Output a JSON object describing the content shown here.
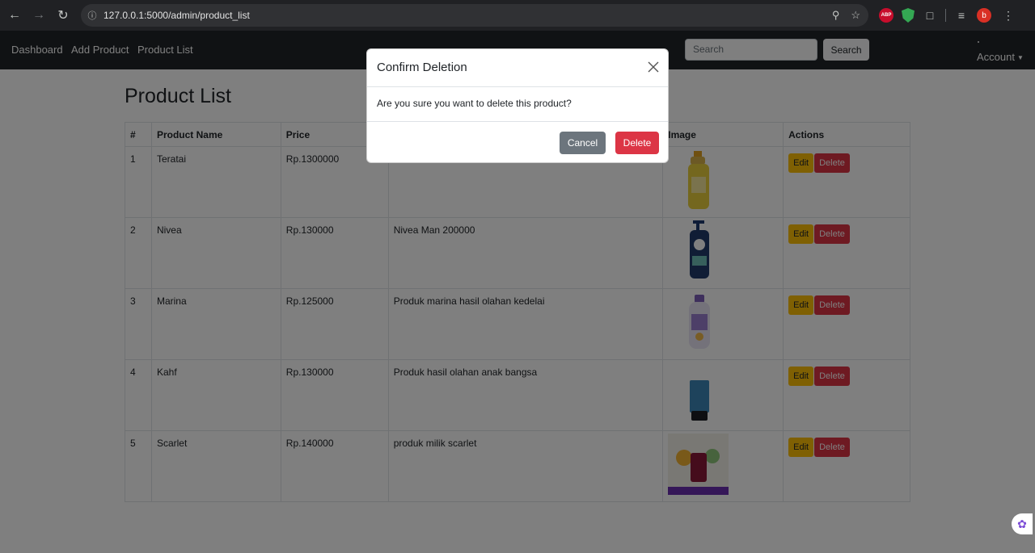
{
  "browser": {
    "url": "127.0.0.1:5000/admin/product_list",
    "extensions": {
      "abp_label": "ABP",
      "profile_initial": "b"
    }
  },
  "navbar": {
    "links": [
      "Dashboard",
      "Add Product",
      "Product List"
    ],
    "search_placeholder": "Search",
    "search_button": "Search",
    "account_label": "Account"
  },
  "page": {
    "title": "Product List",
    "columns": [
      "#",
      "Product Name",
      "Price",
      "",
      "Image",
      "Actions"
    ],
    "rows": [
      {
        "num": "1",
        "name": "Teratai",
        "price": "Rp.1300000",
        "description": "",
        "image": "yellow-bottle"
      },
      {
        "num": "2",
        "name": "Nivea",
        "price": "Rp.130000",
        "description": "Nivea Man 200000",
        "image": "blue-pump-bottle"
      },
      {
        "num": "3",
        "name": "Marina",
        "price": "Rp.125000",
        "description": "Produk marina hasil olahan kedelai",
        "image": "purple-lotion-bottle"
      },
      {
        "num": "4",
        "name": "Kahf",
        "price": "Rp.130000",
        "description": "Produk hasil olahan anak bangsa",
        "image": "blue-tube"
      },
      {
        "num": "5",
        "name": "Scarlet",
        "price": "Rp.140000",
        "description": "produk milik scarlet",
        "image": "product-box"
      }
    ],
    "edit_label": "Edit",
    "delete_label": "Delete"
  },
  "modal": {
    "title": "Confirm Deletion",
    "message": "Are you sure you want to delete this product?",
    "cancel_label": "Cancel",
    "confirm_label": "Delete"
  },
  "colors": {
    "navbar": "#212529",
    "edit": "#ffc107",
    "delete": "#dc3545",
    "cancel": "#6c757d"
  }
}
